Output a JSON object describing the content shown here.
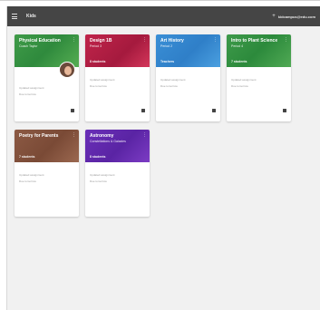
{
  "app": {
    "title": "Kids",
    "add_label": "+",
    "user": "kidcampus@edu.com"
  },
  "cards": [
    {
      "title": "Physical Education",
      "subtitle": "Coach Taylor",
      "count": "",
      "meta1": "Updated assignment",
      "meta2": "Due tomorrow",
      "color": "#3f9b48",
      "has_avatar": true
    },
    {
      "title": "Design 1B",
      "subtitle": "Period 3",
      "count": "8 students",
      "meta1": "Updated assignment",
      "meta2": "Due tomorrow",
      "color": "#c0244a",
      "has_avatar": false
    },
    {
      "title": "Art History",
      "subtitle": "Period 2",
      "count": "Teachers",
      "meta1": "Updated assignment",
      "meta2": "Due tomorrow",
      "color": "#3a8fd6",
      "has_avatar": false
    },
    {
      "title": "Intro to Plant Science",
      "subtitle": "Period 4",
      "count": "7 students",
      "meta1": "Updated assignment",
      "meta2": "Due tomorrow",
      "color": "#3e9a4a",
      "has_avatar": false
    },
    {
      "title": "Poetry for Parents",
      "subtitle": "",
      "count": "7 students",
      "meta1": "Updated assignment",
      "meta2": "Due tomorrow",
      "color": "#8c5a44",
      "has_avatar": false
    },
    {
      "title": "Astronomy",
      "subtitle": "Constellations & Galaxies",
      "count": "8 students",
      "meta1": "Updated assignment",
      "meta2": "Due tomorrow",
      "color": "#6a2fb8",
      "has_avatar": false
    }
  ]
}
